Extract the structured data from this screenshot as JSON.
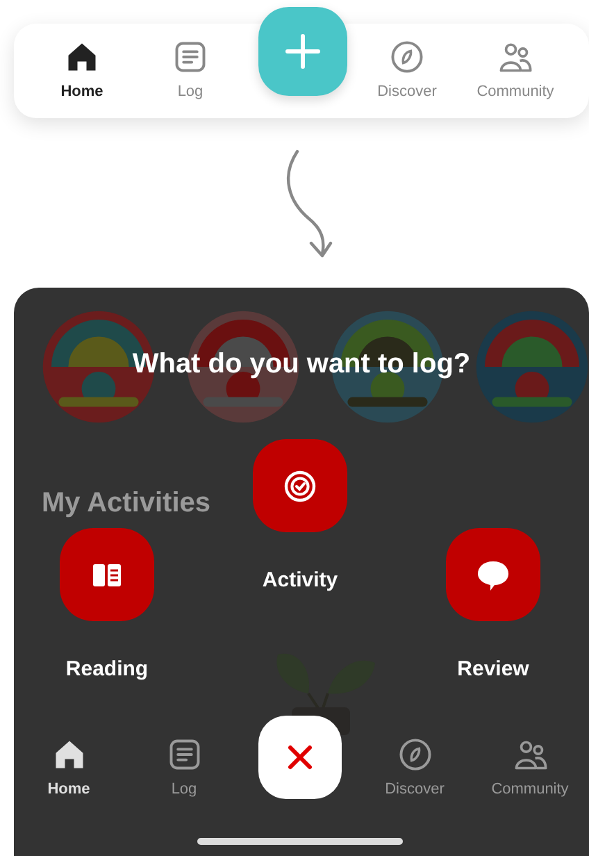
{
  "top_nav": {
    "items": [
      {
        "label": "Home",
        "kind": "home",
        "selected": true
      },
      {
        "label": "Log",
        "kind": "log",
        "selected": false
      },
      {
        "label": "Discover",
        "kind": "discover",
        "selected": false
      },
      {
        "label": "Community",
        "kind": "community",
        "selected": false
      }
    ]
  },
  "app_screen": {
    "heading": "My Activities",
    "log_menu": {
      "title": "What do you want to log?",
      "options": [
        {
          "label": "Activity",
          "kind": "activity"
        },
        {
          "label": "Reading",
          "kind": "reading"
        },
        {
          "label": "Review",
          "kind": "review"
        }
      ]
    },
    "bottom_nav": {
      "items": [
        {
          "label": "Home",
          "kind": "home",
          "selected": true
        },
        {
          "label": "Log",
          "kind": "log",
          "selected": false
        },
        {
          "label": "Discover",
          "kind": "discover",
          "selected": false
        },
        {
          "label": "Community",
          "kind": "community",
          "selected": false
        }
      ]
    }
  }
}
